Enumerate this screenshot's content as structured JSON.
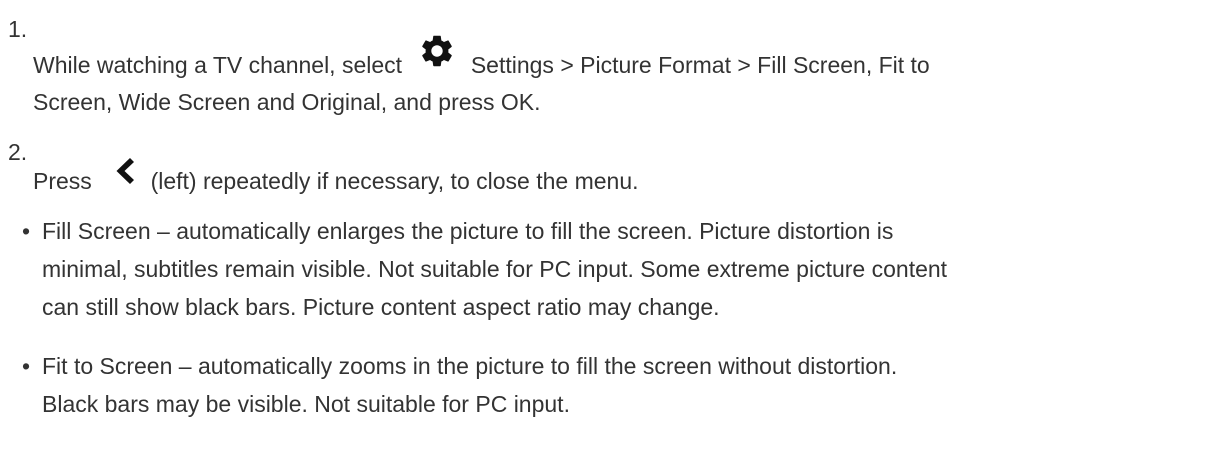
{
  "steps": [
    {
      "number": "1.",
      "line1_before": "While watching a TV channel, select",
      "line1_after": "Settings > Picture Format > Fill Screen, Fit to",
      "line2": "Screen, Wide Screen and Original, and press OK.",
      "icon": "gear-icon"
    },
    {
      "number": "2.",
      "before": "Press",
      "after": "(left) repeatedly if necessary, to close the menu.",
      "icon": "chevron-left-icon"
    }
  ],
  "bullets": [
    {
      "marker": "•",
      "lines": [
        "Fill Screen – automatically enlarges the picture to fill the screen. Picture distortion is",
        "minimal, subtitles remain visible. Not suitable for PC input. Some extreme picture content",
        "can still show black bars. Picture content aspect ratio may change."
      ]
    },
    {
      "marker": "•",
      "lines": [
        "Fit to Screen – automatically zooms in the picture to fill the screen without distortion.",
        "Black bars may be visible. Not suitable for PC input."
      ]
    }
  ],
  "colors": {
    "text": "#333333",
    "icon": "#111111"
  }
}
